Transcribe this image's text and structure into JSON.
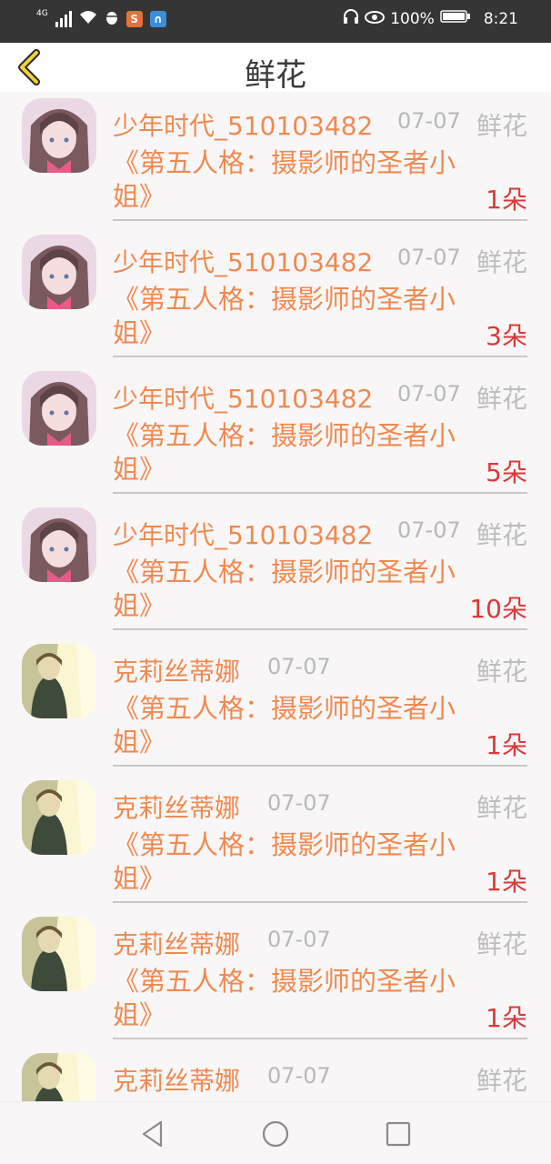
{
  "status_bar": {
    "network": "4G",
    "battery": "100%",
    "time": "8:21"
  },
  "header": {
    "title": "鲜花"
  },
  "items": [
    {
      "user": "少年时代_510103482",
      "date": "07-07",
      "category": "鲜花",
      "work": "《第五人格：摄影师的圣者小姐》",
      "count": "1朵",
      "avatar": "avatar-girl"
    },
    {
      "user": "少年时代_510103482",
      "date": "07-07",
      "category": "鲜花",
      "work": "《第五人格：摄影师的圣者小姐》",
      "count": "3朵",
      "avatar": "avatar-girl"
    },
    {
      "user": "少年时代_510103482",
      "date": "07-07",
      "category": "鲜花",
      "work": "《第五人格：摄影师的圣者小姐》",
      "count": "5朵",
      "avatar": "avatar-girl"
    },
    {
      "user": "少年时代_510103482",
      "date": "07-07",
      "category": "鲜花",
      "work": "《第五人格：摄影师的圣者小姐》",
      "count": "10朵",
      "avatar": "avatar-girl"
    },
    {
      "user": "克莉丝蒂娜",
      "date": "07-07",
      "category": "鲜花",
      "work": "《第五人格：摄影师的圣者小姐》",
      "count": "1朵",
      "avatar": "avatar-portrait"
    },
    {
      "user": "克莉丝蒂娜",
      "date": "07-07",
      "category": "鲜花",
      "work": "《第五人格：摄影师的圣者小姐》",
      "count": "1朵",
      "avatar": "avatar-portrait"
    },
    {
      "user": "克莉丝蒂娜",
      "date": "07-07",
      "category": "鲜花",
      "work": "《第五人格：摄影师的圣者小姐》",
      "count": "1朵",
      "avatar": "avatar-portrait"
    },
    {
      "user": "克莉丝蒂娜",
      "date": "07-07",
      "category": "鲜花",
      "work": "",
      "count": "",
      "avatar": "avatar-portrait"
    }
  ],
  "nav": {
    "back": "back-triangle-icon",
    "home": "home-circle-icon",
    "recents": "recents-square-icon"
  }
}
